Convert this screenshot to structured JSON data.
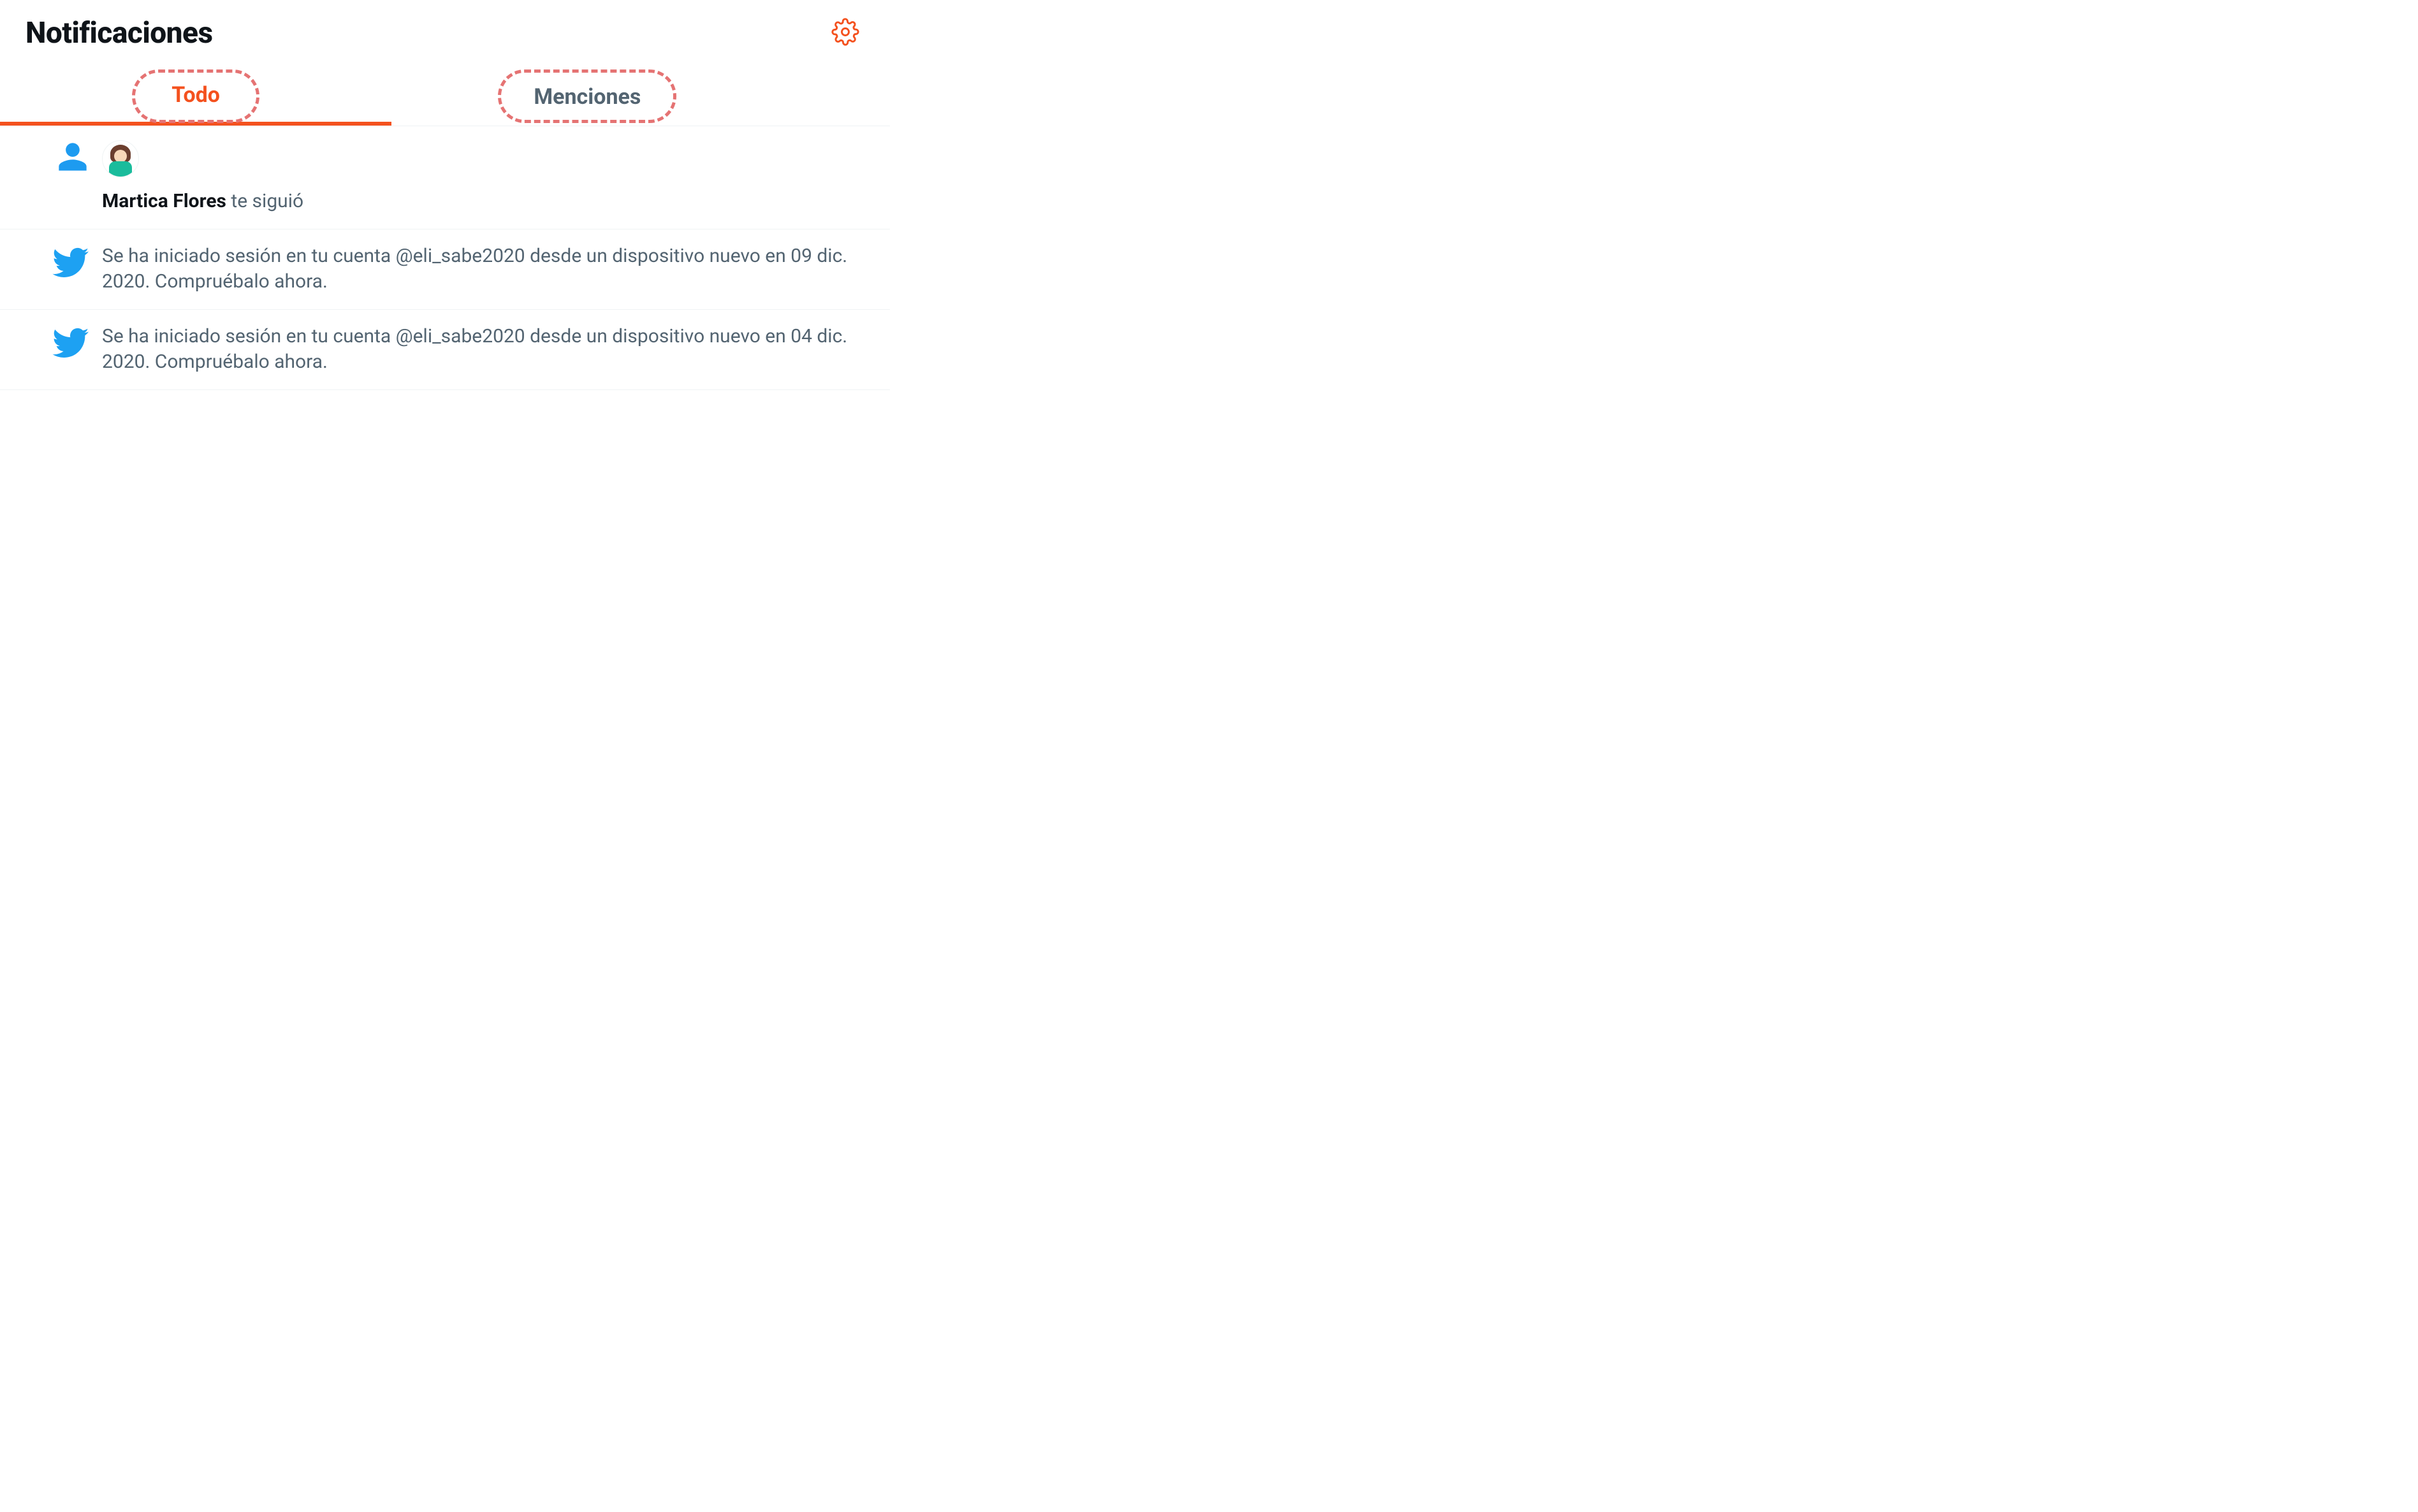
{
  "header": {
    "title": "Notificaciones"
  },
  "tabs": {
    "all": {
      "label": "Todo",
      "active": true
    },
    "mentions": {
      "label": "Menciones",
      "active": false
    }
  },
  "notifications": [
    {
      "type": "follow",
      "actor_name": "Martica Flores",
      "action_text": "te siguió"
    },
    {
      "type": "login",
      "text": "Se ha iniciado sesión en tu cuenta @eli_sabe2020 desde un dispositivo nuevo en 09 dic. 2020. Compruébalo ahora."
    },
    {
      "type": "login",
      "text": "Se ha iniciado sesión en tu cuenta @eli_sabe2020 desde un dispositivo nuevo en 04 dic. 2020. Compruébalo ahora."
    }
  ],
  "colors": {
    "accent": "#f4511e",
    "twitter_blue": "#1DA1F2",
    "person_blue": "#1D9BF0",
    "text_muted": "#536471",
    "highlight_dash": "#e57373"
  }
}
